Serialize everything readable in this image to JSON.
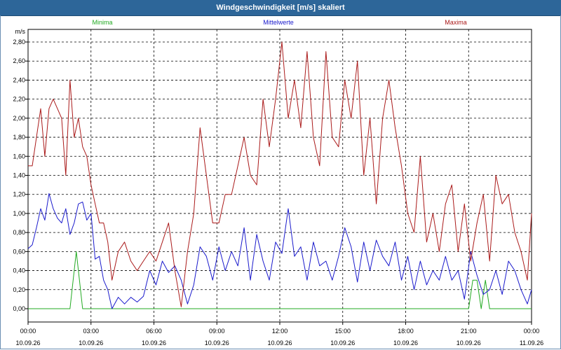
{
  "window": {
    "title": "Windgeschwindigkeit [m/s] skaliert"
  },
  "chart_data": {
    "type": "line",
    "title": "Windgeschwindigkeit [m/s] skaliert",
    "ylabel": "m/s",
    "ylim": [
      0,
      2.8
    ],
    "yticks": [
      "0,00",
      "0,20",
      "0,40",
      "0,60",
      "0,80",
      "1,00",
      "1,20",
      "1,40",
      "1,60",
      "1,80",
      "2,00",
      "2,20",
      "2,40",
      "2,60",
      "2,80"
    ],
    "xlim": [
      0,
      24
    ],
    "xticks": [
      {
        "time": "00:00",
        "date": "10.09.26"
      },
      {
        "time": "03:00",
        "date": "10.09.26"
      },
      {
        "time": "06:00",
        "date": "10.09.26"
      },
      {
        "time": "09:00",
        "date": "10.09.26"
      },
      {
        "time": "12:00",
        "date": "10.09.26"
      },
      {
        "time": "15:00",
        "date": "10.09.26"
      },
      {
        "time": "18:00",
        "date": "10.09.26"
      },
      {
        "time": "21:00",
        "date": "10.09.26"
      },
      {
        "time": "00:00",
        "date": "11.09.26"
      }
    ],
    "grid": true,
    "series": [
      {
        "name": "Minima",
        "color": "#22aa22",
        "x": [
          0,
          2.0,
          2.3,
          2.6,
          21.0,
          21.2,
          21.4,
          21.6,
          21.8,
          22.0,
          22.2,
          24.0
        ],
        "y": [
          0,
          0,
          0.6,
          0,
          0,
          0.3,
          0.3,
          0,
          0.3,
          0,
          0,
          0
        ]
      },
      {
        "name": "Mittelwerte",
        "color": "#1a1acc",
        "x": [
          0,
          0.2,
          0.4,
          0.6,
          0.8,
          1.0,
          1.2,
          1.4,
          1.6,
          1.8,
          2.0,
          2.2,
          2.4,
          2.6,
          2.8,
          3.0,
          3.2,
          3.4,
          3.6,
          3.8,
          4.0,
          4.3,
          4.6,
          4.9,
          5.2,
          5.5,
          5.8,
          6.1,
          6.4,
          6.7,
          7.0,
          7.3,
          7.6,
          7.9,
          8.2,
          8.5,
          8.8,
          9.1,
          9.4,
          9.7,
          10.0,
          10.3,
          10.6,
          10.9,
          11.2,
          11.5,
          11.8,
          12.1,
          12.4,
          12.7,
          13.0,
          13.3,
          13.6,
          13.9,
          14.2,
          14.5,
          14.8,
          15.1,
          15.4,
          15.7,
          16.0,
          16.3,
          16.6,
          16.9,
          17.2,
          17.5,
          17.8,
          18.1,
          18.4,
          18.7,
          19.0,
          19.3,
          19.6,
          19.9,
          20.2,
          20.5,
          20.8,
          21.1,
          21.4,
          21.7,
          22.0,
          22.3,
          22.6,
          22.9,
          23.2,
          23.5,
          23.8,
          24.0
        ],
        "y": [
          0.63,
          0.67,
          0.85,
          1.05,
          0.93,
          1.21,
          1.05,
          0.95,
          0.9,
          1.05,
          0.78,
          0.9,
          1.1,
          1.12,
          0.93,
          1.0,
          0.52,
          0.55,
          0.3,
          0.2,
          0.0,
          0.12,
          0.05,
          0.12,
          0.07,
          0.13,
          0.4,
          0.25,
          0.5,
          0.38,
          0.45,
          0.3,
          0.05,
          0.25,
          0.65,
          0.55,
          0.3,
          0.65,
          0.4,
          0.6,
          0.45,
          0.85,
          0.3,
          0.78,
          0.5,
          0.3,
          0.7,
          0.58,
          1.05,
          0.55,
          0.65,
          0.3,
          0.7,
          0.45,
          0.5,
          0.3,
          0.55,
          0.85,
          0.65,
          0.28,
          0.7,
          0.4,
          0.72,
          0.55,
          0.45,
          0.7,
          0.3,
          0.55,
          0.2,
          0.5,
          0.25,
          0.4,
          0.3,
          0.55,
          0.3,
          0.4,
          0.1,
          0.6,
          0.35,
          0.15,
          0.2,
          0.4,
          0.15,
          0.5,
          0.4,
          0.2,
          0.05,
          0.2
        ]
      },
      {
        "name": "Maxima",
        "color": "#aa1a1a",
        "x": [
          0,
          0.2,
          0.4,
          0.6,
          0.8,
          1.0,
          1.2,
          1.4,
          1.6,
          1.8,
          2.0,
          2.2,
          2.4,
          2.6,
          2.8,
          3.0,
          3.2,
          3.4,
          3.6,
          3.8,
          4.0,
          4.3,
          4.6,
          4.9,
          5.2,
          5.5,
          5.8,
          6.1,
          6.4,
          6.7,
          7.0,
          7.3,
          7.6,
          7.9,
          8.2,
          8.5,
          8.8,
          9.1,
          9.4,
          9.7,
          10.0,
          10.3,
          10.6,
          10.9,
          11.2,
          11.5,
          11.8,
          12.1,
          12.4,
          12.7,
          13.0,
          13.3,
          13.6,
          13.9,
          14.2,
          14.5,
          14.8,
          15.1,
          15.4,
          15.7,
          16.0,
          16.3,
          16.6,
          16.9,
          17.2,
          17.5,
          17.8,
          18.1,
          18.4,
          18.7,
          19.0,
          19.3,
          19.6,
          19.9,
          20.2,
          20.5,
          20.8,
          21.1,
          21.4,
          21.7,
          22.0,
          22.3,
          22.6,
          22.9,
          23.2,
          23.5,
          23.8,
          24.0
        ],
        "y": [
          1.5,
          1.5,
          1.8,
          2.1,
          1.6,
          2.1,
          2.2,
          2.1,
          2.0,
          1.4,
          2.4,
          1.8,
          2.0,
          1.7,
          1.6,
          1.3,
          1.1,
          0.9,
          0.9,
          0.7,
          0.3,
          0.6,
          0.7,
          0.5,
          0.4,
          0.5,
          0.6,
          0.5,
          0.7,
          0.9,
          0.4,
          0.02,
          0.6,
          1.0,
          1.9,
          1.4,
          0.9,
          0.9,
          1.2,
          1.2,
          1.5,
          1.8,
          1.4,
          1.3,
          2.2,
          1.7,
          2.2,
          2.8,
          2.0,
          2.4,
          1.9,
          2.7,
          1.8,
          1.5,
          2.7,
          1.8,
          1.7,
          2.4,
          2.0,
          2.6,
          1.4,
          2.0,
          1.1,
          2.0,
          2.4,
          1.9,
          1.5,
          1.0,
          0.8,
          1.6,
          0.7,
          1.0,
          0.6,
          1.1,
          1.3,
          0.6,
          1.1,
          0.5,
          0.9,
          1.2,
          0.5,
          1.4,
          1.1,
          1.2,
          0.8,
          0.6,
          0.3,
          1.0
        ]
      }
    ]
  }
}
